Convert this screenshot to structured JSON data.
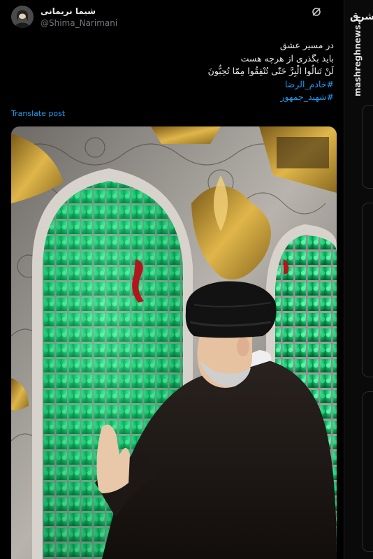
{
  "tweet": {
    "author_name": "شیما نریمانی",
    "author_handle": "@Shima_Narimani",
    "text_lines": [
      "در مسیر عشق",
      "باید بگذری از هرچه هست",
      "لَنْ تَنالُوا الْبِرَّ حَتّٰى تُنْفِقُوا مِمّا تُحِبُّونَ"
    ],
    "hashtags": [
      "#خادم_الرضا",
      "#شهید_جمهور"
    ],
    "translate_label": "Translate post",
    "icons": {
      "more": "grok-icon"
    }
  },
  "brand": {
    "logo_text": "مشرق",
    "url": "mashreghnews.ir"
  },
  "colors": {
    "background": "#000000",
    "link": "#1d9bf0",
    "text": "#e7e9ea",
    "secondary": "#71767b"
  }
}
